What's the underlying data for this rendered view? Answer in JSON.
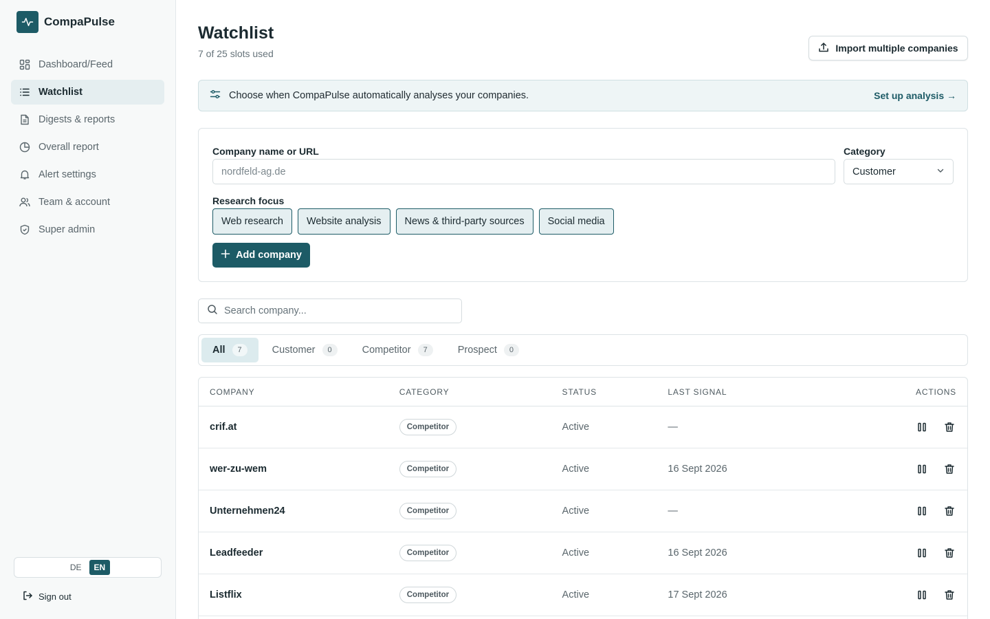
{
  "app": {
    "name": "CompaPulse",
    "logo_icon": "pulse-icon",
    "brand_color": "#1d5b66"
  },
  "sidebar": {
    "items": [
      {
        "label": "Dashboard/Feed",
        "icon": "dashboard-grid-icon"
      },
      {
        "label": "Watchlist",
        "icon": "list-icon",
        "active": true
      },
      {
        "label": "Digests & reports",
        "icon": "document-icon"
      },
      {
        "label": "Overall report",
        "icon": "pie-chart-icon"
      },
      {
        "label": "Alert settings",
        "icon": "bell-icon"
      },
      {
        "label": "Team & account",
        "icon": "users-icon"
      },
      {
        "label": "Super admin",
        "icon": "shield-icon"
      }
    ],
    "language": {
      "options": [
        "DE",
        "EN"
      ],
      "selected": "EN"
    },
    "signout_label": "Sign out"
  },
  "header": {
    "title": "Watchlist",
    "subtitle": "7 of 25 slots used",
    "import_label": "Import multiple companies"
  },
  "banner": {
    "text": "Choose when CompaPulse automatically analyses your companies.",
    "link": "Set up analysis →"
  },
  "form": {
    "company_label": "Company name or URL",
    "company_placeholder": "nordfeld-ag.de",
    "category_label": "Category",
    "category_value": "Customer",
    "focus_label": "Research focus",
    "focus_options": [
      "Web research",
      "Website analysis",
      "News & third-party sources",
      "Social media"
    ],
    "add_label": "Add company"
  },
  "search": {
    "placeholder": "Search company..."
  },
  "filters": [
    {
      "label": "All",
      "count": "7",
      "active": true
    },
    {
      "label": "Customer",
      "count": "0"
    },
    {
      "label": "Competitor",
      "count": "7"
    },
    {
      "label": "Prospect",
      "count": "0"
    }
  ],
  "table": {
    "headers": [
      "COMPANY",
      "CATEGORY",
      "STATUS",
      "LAST SIGNAL",
      "ACTIONS"
    ],
    "rows": [
      {
        "company": "crif.at",
        "category": "Competitor",
        "status": "Active",
        "last_signal": "—"
      },
      {
        "company": "wer-zu-wem",
        "category": "Competitor",
        "status": "Active",
        "last_signal": "16 Sept 2026"
      },
      {
        "company": "Unternehmen24",
        "category": "Competitor",
        "status": "Active",
        "last_signal": "—"
      },
      {
        "company": "Leadfeeder",
        "category": "Competitor",
        "status": "Active",
        "last_signal": "16 Sept 2026"
      },
      {
        "company": "Listflix",
        "category": "Competitor",
        "status": "Active",
        "last_signal": "17 Sept 2026"
      }
    ]
  }
}
